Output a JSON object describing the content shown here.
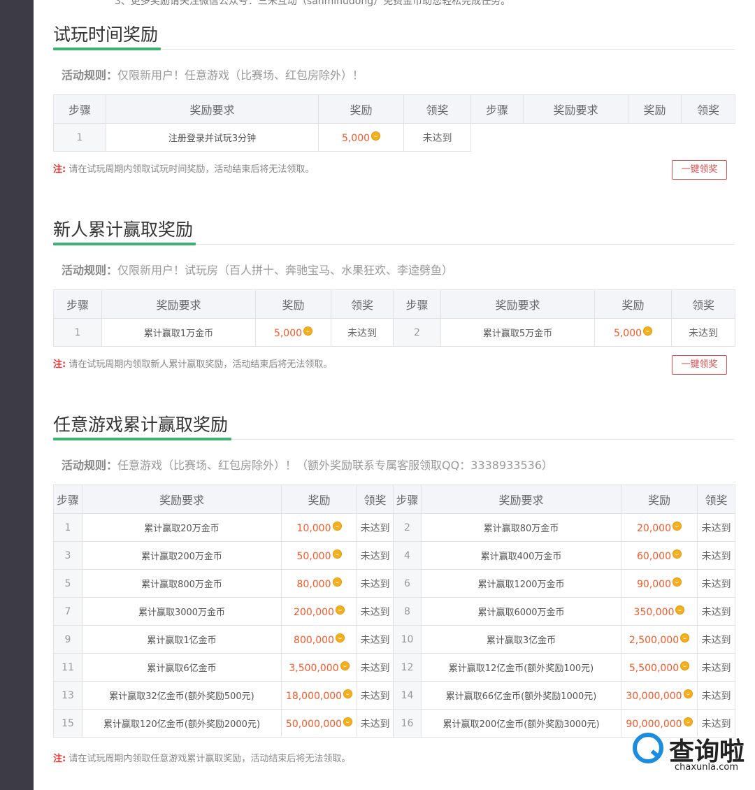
{
  "top_cut_text": "3、更多奖励请关注微信公众号：三米互动（sanmihudong）免费金币助您轻松完成任务。",
  "headers": {
    "step": "步骤",
    "req": "奖励要求",
    "reward": "奖励",
    "claim": "领奖"
  },
  "claim_all_label": "一键领奖",
  "sections": [
    {
      "title": "试玩时间奖励",
      "rule_label": "活动规则：",
      "rule_text": "仅限新用户！任意游戏（比赛场、红包房除外）！",
      "note_label": "注:",
      "note_text": "请在试玩周期内领取试玩时间奖励，活动结束后将无法领取。",
      "rows": [
        {
          "step": "1",
          "req": "注册登录并试玩3分钟",
          "reward": "5,000",
          "claim": "未达到"
        }
      ]
    },
    {
      "title": "新人累计赢取奖励",
      "rule_label": "活动规则：",
      "rule_text": "仅限新用户！试玩房（百人拼十、奔驰宝马、水果狂欢、李逵劈鱼）",
      "note_label": "注:",
      "note_text": "请在试玩周期内领取新人累计赢取奖励，活动结束后将无法领取。",
      "rows": [
        {
          "step": "1",
          "req": "累计赢取1万金币",
          "reward": "5,000",
          "claim": "未达到"
        },
        {
          "step": "2",
          "req": "累计赢取5万金币",
          "reward": "5,000",
          "claim": "未达到"
        }
      ]
    },
    {
      "title": "任意游戏累计赢取奖励",
      "rule_label": "活动规则：",
      "rule_text": "任意游戏（比赛场、红包房除外）！（额外奖励联系专属客服领取QQ：3338933536）",
      "note_label": "注:",
      "note_text": "请在试玩周期内领取任意游戏累计赢取奖励，活动结束后将无法领取。",
      "rows": [
        {
          "step": "1",
          "req": "累计赢取20万金币",
          "reward": "10,000",
          "claim": "未达到"
        },
        {
          "step": "2",
          "req": "累计赢取80万金币",
          "reward": "20,000",
          "claim": "未达到"
        },
        {
          "step": "3",
          "req": "累计赢取200万金币",
          "reward": "50,000",
          "claim": "未达到"
        },
        {
          "step": "4",
          "req": "累计赢取400万金币",
          "reward": "60,000",
          "claim": "未达到"
        },
        {
          "step": "5",
          "req": "累计赢取800万金币",
          "reward": "80,000",
          "claim": "未达到"
        },
        {
          "step": "6",
          "req": "累计赢取1200万金币",
          "reward": "90,000",
          "claim": "未达到"
        },
        {
          "step": "7",
          "req": "累计赢取3000万金币",
          "reward": "200,000",
          "claim": "未达到"
        },
        {
          "step": "8",
          "req": "累计赢取6000万金币",
          "reward": "350,000",
          "claim": "未达到"
        },
        {
          "step": "9",
          "req": "累计赢取1亿金币",
          "reward": "800,000",
          "claim": "未达到"
        },
        {
          "step": "10",
          "req": "累计赢取3亿金币",
          "reward": "2,500,000",
          "claim": "未达到"
        },
        {
          "step": "11",
          "req": "累计赢取6亿金币",
          "reward": "3,500,000",
          "claim": "未达到"
        },
        {
          "step": "12",
          "req": "累计赢取12亿金币(额外奖励100元)",
          "reward": "5,500,000",
          "claim": "未达到"
        },
        {
          "step": "13",
          "req": "累计赢取32亿金币(额外奖励500元)",
          "reward": "18,000,000",
          "claim": "未达到"
        },
        {
          "step": "14",
          "req": "累计赢取66亿金币(额外奖励1000元)",
          "reward": "30,000,000",
          "claim": "未达到"
        },
        {
          "step": "15",
          "req": "累计赢取120亿金币(额外奖励2000元)",
          "reward": "50,000,000",
          "claim": "未达到"
        },
        {
          "step": "16",
          "req": "累计赢取200亿金币(额外奖励3000元)",
          "reward": "90,000,000",
          "claim": "未达到"
        }
      ]
    }
  ],
  "watermark": {
    "text": "查询啦",
    "url": "chaxunla.com"
  }
}
